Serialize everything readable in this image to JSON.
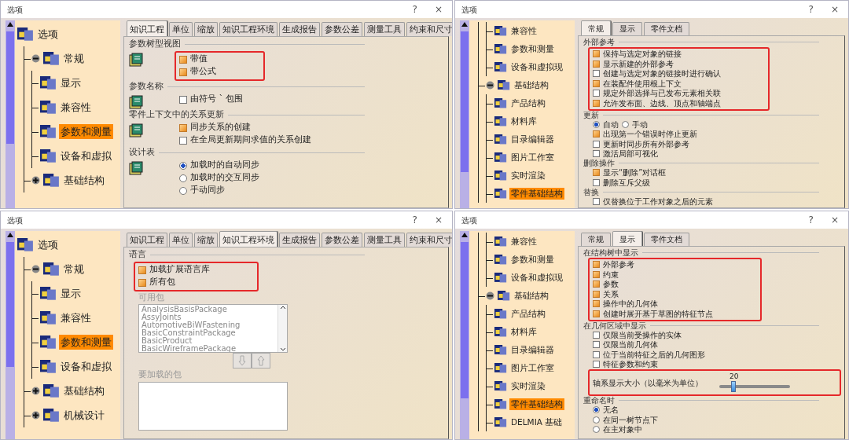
{
  "windows": [
    {
      "title": "选项",
      "help": "?",
      "close": "×",
      "tree": [
        {
          "label": "选项",
          "selected": false,
          "children": [
            {
              "label": "常规",
              "selected": false,
              "expanded": true,
              "children": [
                {
                  "label": "显示",
                  "selected": false
                },
                {
                  "label": "兼容性",
                  "selected": false
                },
                {
                  "label": "参数和测量",
                  "selected": true
                },
                {
                  "label": "设备和虚拟",
                  "selected": false
                }
              ]
            },
            {
              "label": "基础结构",
              "selected": false,
              "expanded": false
            }
          ]
        }
      ],
      "tabs": [
        {
          "label": "知识工程",
          "selected": true
        },
        {
          "label": "单位",
          "selected": false
        },
        {
          "label": "缩放",
          "selected": false
        },
        {
          "label": "知识工程环境",
          "selected": false
        },
        {
          "label": "生成报告",
          "selected": false
        },
        {
          "label": "参数公差",
          "selected": false
        },
        {
          "label": "测量工具",
          "selected": false
        },
        {
          "label": "约束和尺寸",
          "selected": false
        }
      ],
      "sections": [
        {
          "heading": "参数树型视图",
          "icon": true,
          "groups": [
            {
              "highlighted": true,
              "items": [
                {
                  "kind": "checkbox",
                  "label": "带值",
                  "checked": true
                },
                {
                  "kind": "checkbox",
                  "label": "带公式",
                  "checked": true
                }
              ]
            }
          ]
        },
        {
          "heading": "参数名称",
          "icon": true,
          "groups": [
            {
              "highlighted": false,
              "items": [
                {
                  "kind": "checkbox",
                  "label": "由符号 ` 包围",
                  "checked": false
                }
              ]
            }
          ]
        },
        {
          "heading": "零件上下文中的关系更新",
          "icon": true,
          "groups": [
            {
              "highlighted": false,
              "items": [
                {
                  "kind": "checkbox",
                  "label": "同步关系的创建",
                  "checked": true
                },
                {
                  "kind": "checkbox",
                  "label": "在全局更新期间求值的关系创建",
                  "checked": false
                }
              ]
            }
          ]
        },
        {
          "heading": "设计表",
          "icon": true,
          "groups": [
            {
              "highlighted": false,
              "items": [
                {
                  "kind": "radio",
                  "label": "加载时的自动同步",
                  "selected": true
                },
                {
                  "kind": "radio",
                  "label": "加载时的交互同步",
                  "selected": false
                },
                {
                  "kind": "radio",
                  "label": "手动同步",
                  "selected": false
                }
              ]
            }
          ]
        }
      ]
    },
    {
      "title": "选项",
      "help": "?",
      "close": "×",
      "tree": [
        {
          "children": [
            {
              "children": [
                {
                  "label": "兼容性",
                  "selected": false
                },
                {
                  "label": "参数和测量",
                  "selected": false
                },
                {
                  "label": "设备和虚拟现",
                  "selected": false
                }
              ]
            },
            {
              "label": "基础结构",
              "selected": false,
              "expanded": true,
              "children": [
                {
                  "label": "产品结构",
                  "selected": false
                },
                {
                  "label": "材料库",
                  "selected": false
                },
                {
                  "label": "目录编辑器",
                  "selected": false
                },
                {
                  "label": "图片工作室",
                  "selected": false
                },
                {
                  "label": "实时渲染",
                  "selected": false
                },
                {
                  "label": "零件基础结构",
                  "selected": true
                }
              ]
            }
          ]
        }
      ],
      "tabs": [
        {
          "label": "常规",
          "selected": true
        },
        {
          "label": "显示",
          "selected": false
        },
        {
          "label": "零件文档",
          "selected": false
        }
      ],
      "sections": [
        {
          "heading": "外部参考",
          "groups": [
            {
              "highlighted": true,
              "items": [
                {
                  "kind": "checkbox",
                  "label": "保持与选定对象的链接",
                  "checked": true
                },
                {
                  "kind": "checkbox",
                  "label": "显示新建的外部参考",
                  "checked": true
                },
                {
                  "kind": "checkbox",
                  "label": "创建与选定对象的链接时进行确认",
                  "checked": false
                },
                {
                  "kind": "checkbox",
                  "label": "在装配件使用根上下文",
                  "checked": true
                },
                {
                  "kind": "checkbox",
                  "label": "规定外部选择与已发布元素相关联",
                  "checked": false
                },
                {
                  "kind": "checkbox",
                  "label": "允许发布面、边线、顶点和轴端点",
                  "checked": true
                }
              ]
            }
          ]
        },
        {
          "heading": "更新",
          "groups": [
            {
              "highlighted": false,
              "items": [
                {
                  "kind": "radio-group",
                  "options": [
                    {
                      "label": "自动",
                      "selected": true
                    },
                    {
                      "label": "手动",
                      "selected": false
                    }
                  ]
                },
                {
                  "kind": "checkbox",
                  "label": "出现第一个错误时停止更新",
                  "checked": true
                },
                {
                  "kind": "checkbox",
                  "label": "更新时同步所有外部参考",
                  "checked": false
                },
                {
                  "kind": "checkbox",
                  "label": "激活局部可视化",
                  "checked": false
                }
              ]
            }
          ]
        },
        {
          "heading": "删除操作",
          "groups": [
            {
              "highlighted": false,
              "items": [
                {
                  "kind": "checkbox",
                  "label": "显示“删除”对话框",
                  "checked": true
                },
                {
                  "kind": "checkbox",
                  "label": "删除互斥父级",
                  "checked": false
                }
              ]
            }
          ]
        },
        {
          "heading": "替换",
          "groups": [
            {
              "highlighted": false,
              "items": [
                {
                  "kind": "checkbox",
                  "label": "仅替换位于工作对象之后的元素",
                  "checked": false
                }
              ]
            }
          ]
        }
      ]
    },
    {
      "title": "选项",
      "help": "?",
      "close": "×",
      "tree": [
        {
          "label": "选项",
          "selected": false,
          "children": [
            {
              "label": "常规",
              "selected": false,
              "expanded": true,
              "children": [
                {
                  "label": "显示",
                  "selected": false
                },
                {
                  "label": "兼容性",
                  "selected": false
                },
                {
                  "label": "参数和测量",
                  "selected": true
                },
                {
                  "label": "设备和虚拟",
                  "selected": false
                }
              ]
            },
            {
              "label": "基础结构",
              "selected": false,
              "expanded": false
            },
            {
              "label": "机械设计",
              "selected": false,
              "expanded": false
            }
          ]
        }
      ],
      "tabs": [
        {
          "label": "知识工程",
          "selected": false
        },
        {
          "label": "单位",
          "selected": false
        },
        {
          "label": "缩放",
          "selected": false
        },
        {
          "label": "知识工程环境",
          "selected": true
        },
        {
          "label": "生成报告",
          "selected": false
        },
        {
          "label": "参数公差",
          "selected": false
        },
        {
          "label": "测量工具",
          "selected": false
        },
        {
          "label": "约束和尺寸",
          "selected": false
        }
      ],
      "sections": [
        {
          "heading": "语言",
          "groups": [
            {
              "highlighted": true,
              "items": [
                {
                  "kind": "checkbox",
                  "label": "加载扩展语言库",
                  "checked": true
                },
                {
                  "kind": "checkbox",
                  "label": "所有包",
                  "checked": true
                }
              ]
            },
            {
              "highlighted": false,
              "items": [
                {
                  "kind": "listbox",
                  "label": "可用包",
                  "disabled": true,
                  "options": [
                    "AnalysisBasisPackage",
                    "AssyJoints",
                    "AutomotiveBiWFastening",
                    "BasicConstraintPackage",
                    "BasicProduct",
                    "BasicWireframePackage"
                  ]
                },
                {
                  "kind": "move-buttons",
                  "disabled": true
                },
                {
                  "kind": "listbox",
                  "label": "要加载的包",
                  "disabled": true
                }
              ]
            }
          ]
        }
      ]
    },
    {
      "title": "选项",
      "help": "?",
      "close": "×",
      "tree": [
        {
          "children": [
            {
              "children": [
                {
                  "label": "兼容性",
                  "selected": false
                },
                {
                  "label": "参数和测量",
                  "selected": false
                },
                {
                  "label": "设备和虚拟现",
                  "selected": false
                }
              ]
            },
            {
              "label": "基础结构",
              "selected": false,
              "expanded": true,
              "children": [
                {
                  "label": "产品结构",
                  "selected": false
                },
                {
                  "label": "材料库",
                  "selected": false
                },
                {
                  "label": "目录编辑器",
                  "selected": false
                },
                {
                  "label": "图片工作室",
                  "selected": false
                },
                {
                  "label": "实时渲染",
                  "selected": false
                },
                {
                  "label": "零件基础结构",
                  "selected": true
                },
                {
                  "label": "DELMIA 基础",
                  "selected": false
                }
              ]
            }
          ]
        }
      ],
      "tabs": [
        {
          "label": "常规",
          "selected": false
        },
        {
          "label": "显示",
          "selected": true
        },
        {
          "label": "零件文档",
          "selected": false
        }
      ],
      "sections": [
        {
          "heading": "在结构树中显示",
          "groups": [
            {
              "highlighted": true,
              "items": [
                {
                  "kind": "checkbox",
                  "label": "外部参考",
                  "checked": true
                },
                {
                  "kind": "checkbox",
                  "label": "约束",
                  "checked": true
                },
                {
                  "kind": "checkbox",
                  "label": "参数",
                  "checked": true
                },
                {
                  "kind": "checkbox",
                  "label": "关系",
                  "checked": true
                },
                {
                  "kind": "checkbox",
                  "label": "操作中的几何体",
                  "checked": true
                },
                {
                  "kind": "checkbox",
                  "label": "创建时展开基于草图的特征节点",
                  "checked": true
                }
              ]
            }
          ]
        },
        {
          "heading": "在几何区域中显示",
          "groups": [
            {
              "highlighted": false,
              "items": [
                {
                  "kind": "checkbox",
                  "label": "仅限当前受操作的实体",
                  "checked": false
                },
                {
                  "kind": "checkbox",
                  "label": "仅限当前几何体",
                  "checked": false
                },
                {
                  "kind": "checkbox",
                  "label": "位于当前特征之后的几何图形",
                  "checked": false
                },
                {
                  "kind": "checkbox",
                  "label": "特征参数和约束",
                  "checked": false
                }
              ]
            },
            {
              "highlighted": true,
              "items": [
                {
                  "kind": "slider",
                  "label": "轴系显示大小（以毫米为单位）",
                  "value": "20",
                  "level": 0.2
                }
              ]
            }
          ]
        },
        {
          "heading": "重命名时",
          "groups": [
            {
              "highlighted": false,
              "items": [
                {
                  "kind": "radio",
                  "label": "无名",
                  "selected": true
                },
                {
                  "kind": "radio",
                  "label": "在同一树节点下",
                  "selected": false
                },
                {
                  "kind": "radio",
                  "label": "在主对象中",
                  "selected": false
                }
              ]
            }
          ]
        }
      ]
    }
  ]
}
